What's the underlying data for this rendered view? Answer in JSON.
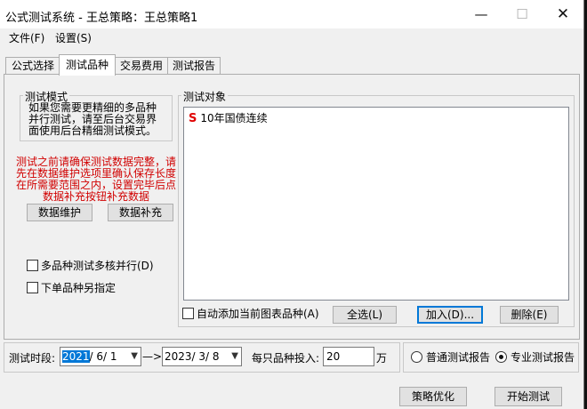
{
  "window": {
    "title": "公式测试系统 - 王总策略：王总策略1",
    "controls": {
      "minimize": "—",
      "maximize": "☐",
      "close": "✕"
    }
  },
  "menu": {
    "file": "文件(F)",
    "settings": "设置(S)"
  },
  "tabs": [
    {
      "label": "公式选择"
    },
    {
      "label": "测试品种"
    },
    {
      "label": "交易费用"
    },
    {
      "label": "测试报告"
    }
  ],
  "active_tab": "测试品种",
  "test_mode": {
    "label": "测试模式",
    "description": "如果您需要更精细的多品种并行测试，请至后台交易界面使用后台精细测试模式。"
  },
  "warning": "测试之前请确保测试数据完整，请先在数据维护选项里确认保存长度在所需要范围之内，设置完毕后点数据补充按钮补充数据",
  "buttons": {
    "data_maintenance": "数据维护",
    "data_supplement": "数据补充",
    "select_all": "全选(L)",
    "add": "加入(D)...",
    "remove": "删除(E)",
    "optimize": "策略优化",
    "start_test": "开始测试"
  },
  "checkboxes": {
    "multi_core": "多品种测试多核并行(D)",
    "order_specify": "下单品种另指定",
    "auto_add": "自动添加当前图表品种(A)"
  },
  "test_objects": {
    "label": "测试对象",
    "items": [
      {
        "badge": "S",
        "name": "10年国债连续"
      }
    ]
  },
  "period": {
    "label": "测试时段:",
    "start_year": "2021",
    "start_rest": "/ 6/ 1",
    "arrow": "—>",
    "end": "2023/ 3/ 8"
  },
  "investment": {
    "label": "每只品种投入:",
    "value": "20",
    "unit": "万"
  },
  "report": {
    "normal": "普通测试报告",
    "professional": "专业测试报告",
    "selected": "专业测试报告"
  }
}
